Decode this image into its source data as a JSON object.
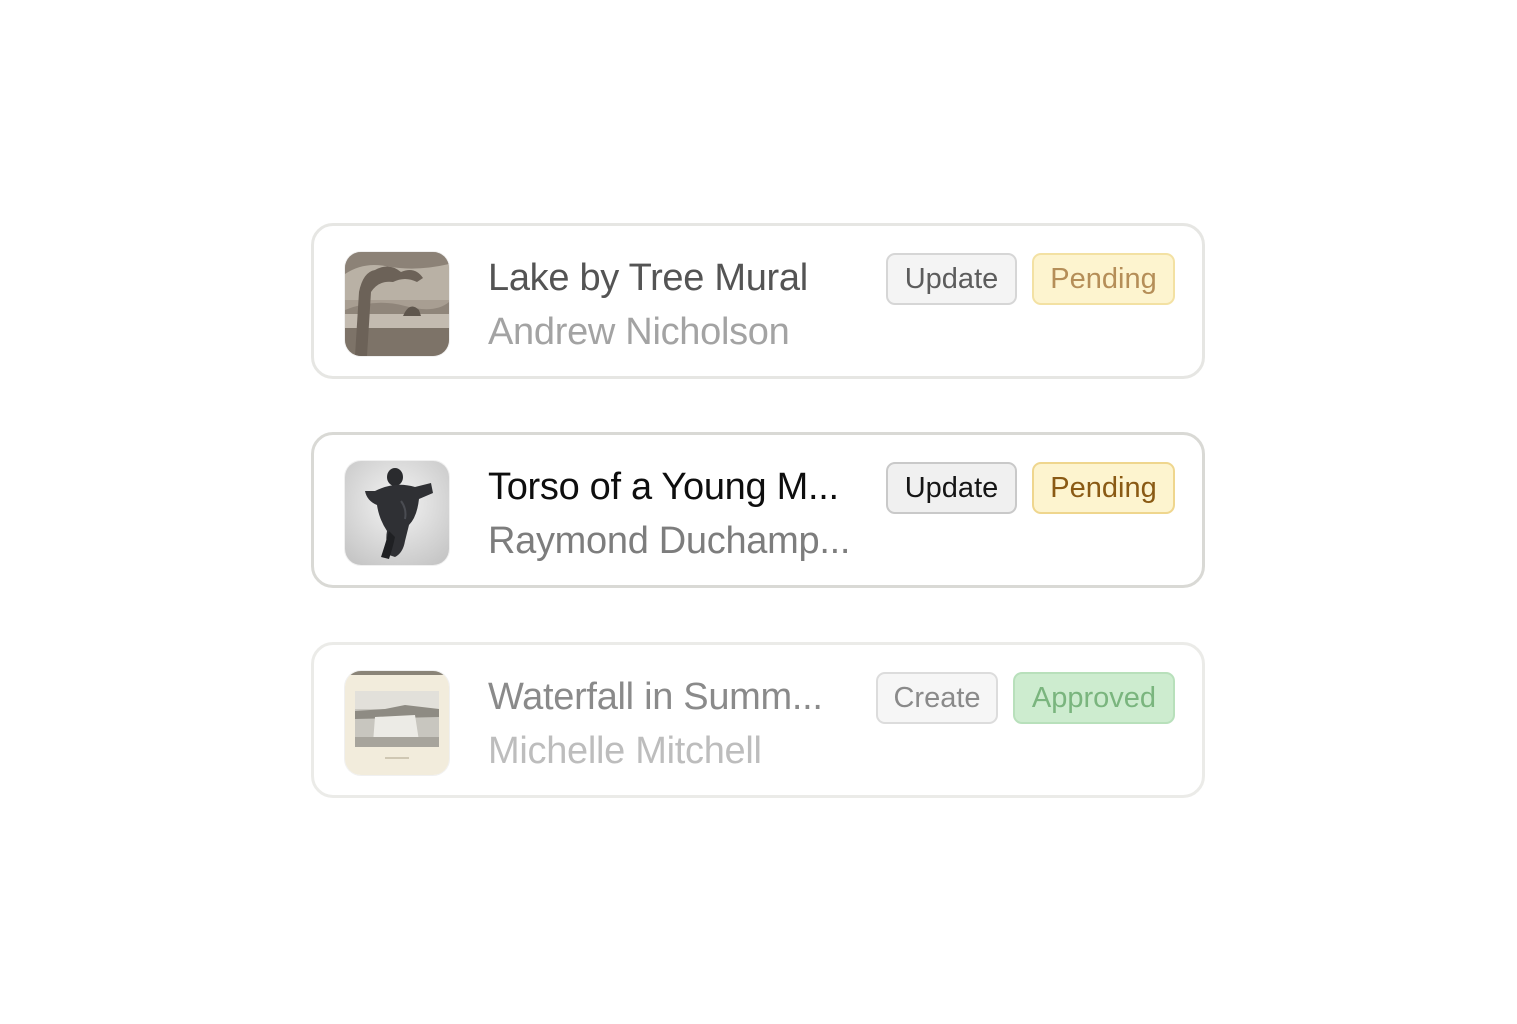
{
  "items": [
    {
      "title": "Lake by Tree Mural",
      "artist": "Andrew Nicholson",
      "action": "Update",
      "status": "Pending",
      "thumbnail": "sepia landscape photograph of a lake framed by a tree"
    },
    {
      "title": "Torso of a Young M...",
      "artist": "Raymond Duchamp...",
      "action": "Update",
      "status": "Pending",
      "thumbnail": "dark bronze sculpture of a male torso"
    },
    {
      "title": "Waterfall in Summ...",
      "artist": "Michelle Mitchell",
      "action": "Create",
      "status": "Approved",
      "thumbnail": "mounted photograph of a waterfall"
    }
  ],
  "colors": {
    "pending_bg": "#fdf4cf",
    "pending_text": "#8a5a14",
    "approved_bg": "#cdeccf",
    "approved_text": "#7ab57e",
    "card_border": "#e6e6e3"
  }
}
